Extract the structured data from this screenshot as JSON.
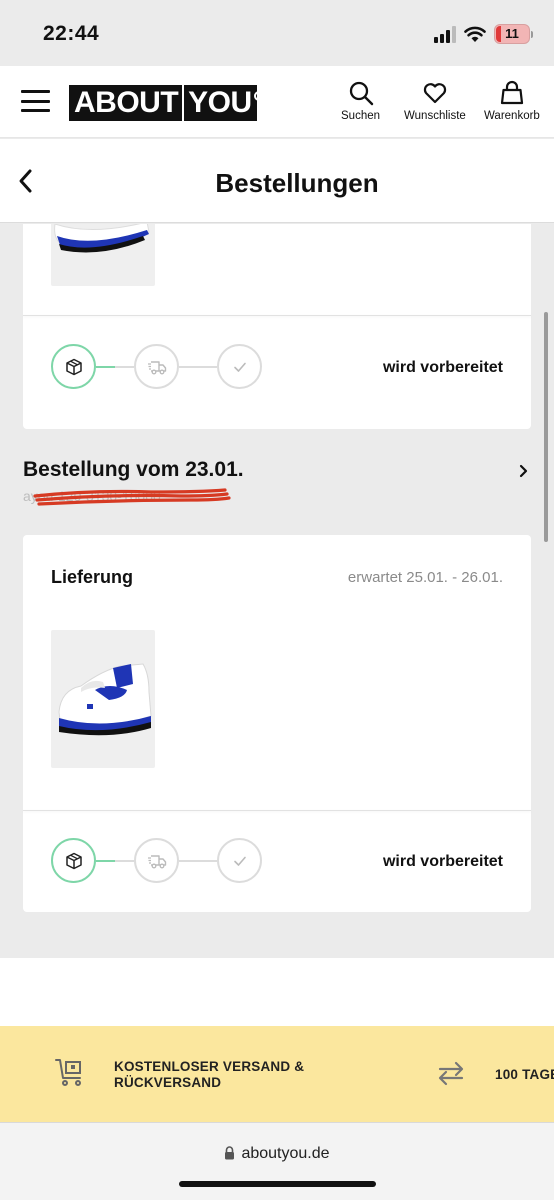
{
  "status_bar": {
    "time": "22:44",
    "battery": "11"
  },
  "header": {
    "logo_left": "ABOUT",
    "logo_right": "YOU",
    "actions": [
      {
        "label": "Suchen",
        "icon": "search-icon"
      },
      {
        "label": "Wunschliste",
        "icon": "heart-icon"
      },
      {
        "label": "Warenkorb",
        "icon": "bag-icon"
      }
    ]
  },
  "page": {
    "title": "Bestellungen"
  },
  "orders": [
    {
      "status": "wird vorbereitet",
      "steps": [
        "package-icon",
        "truck-icon",
        "check-icon"
      ]
    },
    {
      "title": "Bestellung vom 23.01.",
      "number": "ayou-120-3130-16000",
      "delivery_label": "Lieferung",
      "delivery_date": "erwartet 25.01. - 26.01.",
      "status": "wird vorbereitet",
      "steps": [
        "package-icon",
        "truck-icon",
        "check-icon"
      ]
    }
  ],
  "promo": {
    "item1": {
      "line1": "KOSTENLOSER VERSAND &",
      "line2": "RÜCKVERSAND"
    },
    "item2": {
      "text": "100 TAGE"
    }
  },
  "browser": {
    "url": "aboutyou.de"
  },
  "colors": {
    "progress_active": "#7ed6a8",
    "promo_bg": "#fbe79e",
    "scribble": "#d63a23",
    "shoe_blue": "#1f35b5"
  }
}
